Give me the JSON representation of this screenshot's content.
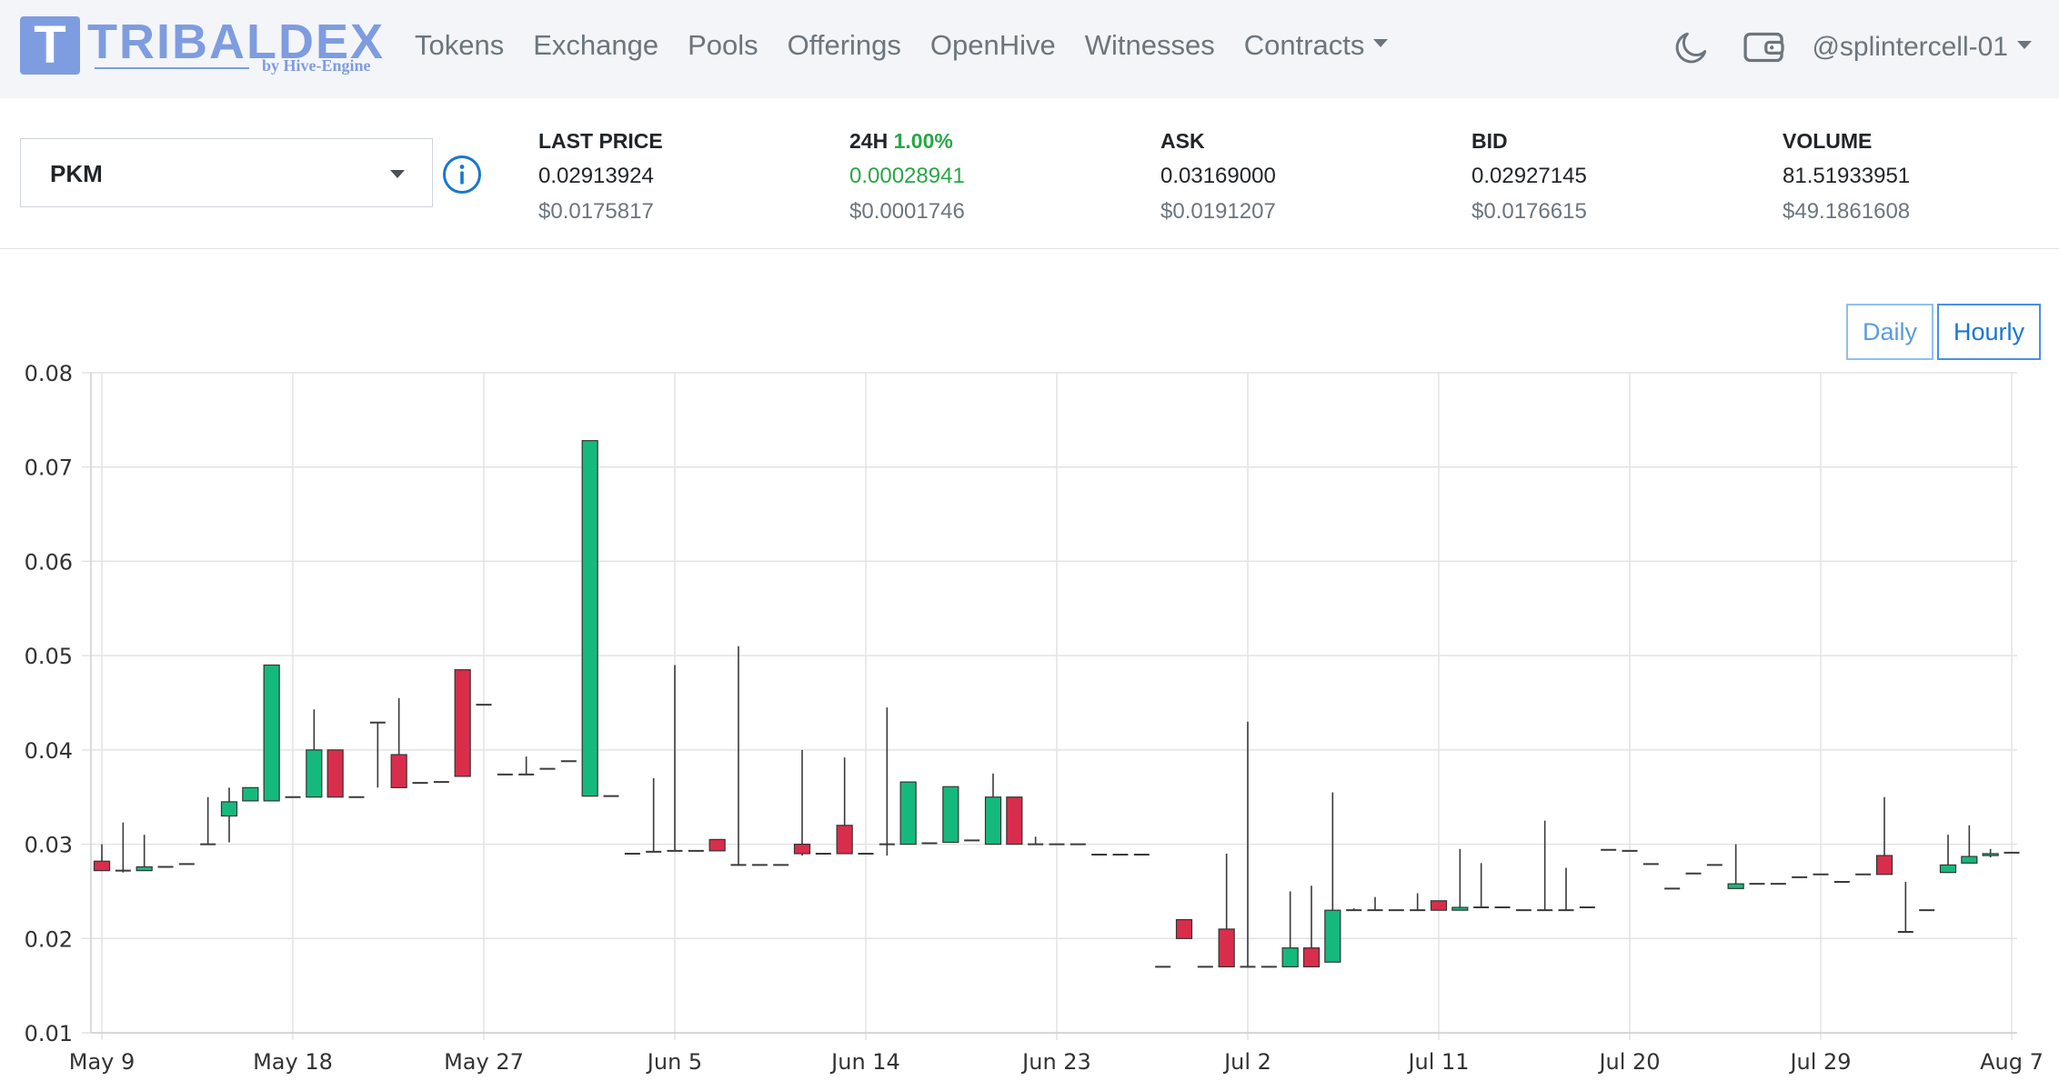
{
  "navbar": {
    "logo_letter": "T",
    "brand_name": "TRIBALDEX",
    "brand_sub": "by Hive-Engine",
    "links": [
      "Tokens",
      "Exchange",
      "Pools",
      "Offerings",
      "OpenHive",
      "Witnesses"
    ],
    "contracts_label": "Contracts",
    "account": "@splintercell-01"
  },
  "ticker": {
    "token": "PKM",
    "last_price": {
      "label": "LAST PRICE",
      "value": "0.02913924",
      "usd": "$0.0175817"
    },
    "change": {
      "label": "24H",
      "pct": "1.00%",
      "value": "0.00028941",
      "usd": "$0.0001746"
    },
    "ask": {
      "label": "ASK",
      "value": "0.03169000",
      "usd": "$0.0191207"
    },
    "bid": {
      "label": "BID",
      "value": "0.02927145",
      "usd": "$0.0176615"
    },
    "volume": {
      "label": "VOLUME",
      "value": "81.51933951",
      "usd": "$49.1861608"
    }
  },
  "chart_controls": {
    "daily": "Daily",
    "hourly": "Hourly"
  },
  "colors": {
    "up": "#16b97d",
    "down": "#d82e4c",
    "accent": "#1976d2",
    "brand": "#7e9ce0"
  },
  "chart_data": {
    "type": "candlestick",
    "ylim": [
      0.01,
      0.08
    ],
    "y_ticks": [
      "0.08",
      "0.07",
      "0.06",
      "0.05",
      "0.04",
      "0.03",
      "0.02",
      "0.01"
    ],
    "x_ticks": [
      "May 9",
      "May 18",
      "May 27",
      "Jun 5",
      "Jun 14",
      "Jun 23",
      "Jul 2",
      "Jul 11",
      "Jul 20",
      "Jul 29",
      "Aug 7"
    ],
    "x_start": "2021-05-09",
    "x_end": "2021-08-07",
    "grid": true,
    "candles": [
      {
        "d": "2021-05-09",
        "o": 0.0282,
        "h": 0.03,
        "l": 0.0272,
        "c": 0.0272
      },
      {
        "d": "2021-05-10",
        "o": 0.0272,
        "h": 0.0323,
        "l": 0.027,
        "c": 0.0272
      },
      {
        "d": "2021-05-11",
        "o": 0.0272,
        "h": 0.031,
        "l": 0.0272,
        "c": 0.0276
      },
      {
        "d": "2021-05-12",
        "o": 0.0276,
        "h": 0.0276,
        "l": 0.0276,
        "c": 0.0276
      },
      {
        "d": "2021-05-13",
        "o": 0.0279,
        "h": 0.0279,
        "l": 0.0279,
        "c": 0.0279
      },
      {
        "d": "2021-05-14",
        "o": 0.03,
        "h": 0.035,
        "l": 0.03,
        "c": 0.03
      },
      {
        "d": "2021-05-15",
        "o": 0.033,
        "h": 0.036,
        "l": 0.0302,
        "c": 0.0345
      },
      {
        "d": "2021-05-16",
        "o": 0.0346,
        "h": 0.036,
        "l": 0.0346,
        "c": 0.036
      },
      {
        "d": "2021-05-17",
        "o": 0.0346,
        "h": 0.049,
        "l": 0.0346,
        "c": 0.049
      },
      {
        "d": "2021-05-18",
        "o": 0.035,
        "h": 0.035,
        "l": 0.035,
        "c": 0.035
      },
      {
        "d": "2021-05-19",
        "o": 0.035,
        "h": 0.0443,
        "l": 0.035,
        "c": 0.04
      },
      {
        "d": "2021-05-20",
        "o": 0.04,
        "h": 0.04,
        "l": 0.035,
        "c": 0.035
      },
      {
        "d": "2021-05-21",
        "o": 0.035,
        "h": 0.035,
        "l": 0.035,
        "c": 0.035
      },
      {
        "d": "2021-05-22",
        "o": 0.0429,
        "h": 0.0429,
        "l": 0.036,
        "c": 0.0429
      },
      {
        "d": "2021-05-23",
        "o": 0.0395,
        "h": 0.0455,
        "l": 0.036,
        "c": 0.036
      },
      {
        "d": "2021-05-24",
        "o": 0.0365,
        "h": 0.0365,
        "l": 0.0365,
        "c": 0.0365
      },
      {
        "d": "2021-05-25",
        "o": 0.0366,
        "h": 0.0366,
        "l": 0.0366,
        "c": 0.0366
      },
      {
        "d": "2021-05-26",
        "o": 0.0485,
        "h": 0.0485,
        "l": 0.0372,
        "c": 0.0372
      },
      {
        "d": "2021-05-27",
        "o": 0.0448,
        "h": 0.0448,
        "l": 0.0448,
        "c": 0.0448
      },
      {
        "d": "2021-05-28",
        "o": 0.0374,
        "h": 0.0374,
        "l": 0.0374,
        "c": 0.0374
      },
      {
        "d": "2021-05-29",
        "o": 0.0374,
        "h": 0.0393,
        "l": 0.0374,
        "c": 0.0374
      },
      {
        "d": "2021-05-30",
        "o": 0.038,
        "h": 0.038,
        "l": 0.038,
        "c": 0.038
      },
      {
        "d": "2021-05-31",
        "o": 0.0388,
        "h": 0.0388,
        "l": 0.0388,
        "c": 0.0388
      },
      {
        "d": "2021-06-01",
        "o": 0.0351,
        "h": 0.0728,
        "l": 0.0351,
        "c": 0.0728
      },
      {
        "d": "2021-06-02",
        "o": 0.0351,
        "h": 0.0351,
        "l": 0.0351,
        "c": 0.0351
      },
      {
        "d": "2021-06-03",
        "o": 0.029,
        "h": 0.029,
        "l": 0.029,
        "c": 0.029
      },
      {
        "d": "2021-06-04",
        "o": 0.0292,
        "h": 0.037,
        "l": 0.0292,
        "c": 0.0292
      },
      {
        "d": "2021-06-05",
        "o": 0.0293,
        "h": 0.049,
        "l": 0.0293,
        "c": 0.0293
      },
      {
        "d": "2021-06-06",
        "o": 0.0293,
        "h": 0.0293,
        "l": 0.0293,
        "c": 0.0293
      },
      {
        "d": "2021-06-07",
        "o": 0.0305,
        "h": 0.0305,
        "l": 0.0293,
        "c": 0.0293
      },
      {
        "d": "2021-06-08",
        "o": 0.0278,
        "h": 0.051,
        "l": 0.0278,
        "c": 0.0278
      },
      {
        "d": "2021-06-09",
        "o": 0.0278,
        "h": 0.0278,
        "l": 0.0278,
        "c": 0.0278
      },
      {
        "d": "2021-06-10",
        "o": 0.0278,
        "h": 0.0278,
        "l": 0.0278,
        "c": 0.0278
      },
      {
        "d": "2021-06-11",
        "o": 0.03,
        "h": 0.04,
        "l": 0.0288,
        "c": 0.029
      },
      {
        "d": "2021-06-12",
        "o": 0.029,
        "h": 0.029,
        "l": 0.029,
        "c": 0.029
      },
      {
        "d": "2021-06-13",
        "o": 0.032,
        "h": 0.0392,
        "l": 0.029,
        "c": 0.029
      },
      {
        "d": "2021-06-14",
        "o": 0.029,
        "h": 0.029,
        "l": 0.029,
        "c": 0.029
      },
      {
        "d": "2021-06-15",
        "o": 0.03,
        "h": 0.0445,
        "l": 0.0288,
        "c": 0.03
      },
      {
        "d": "2021-06-16",
        "o": 0.03,
        "h": 0.0366,
        "l": 0.03,
        "c": 0.0366
      },
      {
        "d": "2021-06-17",
        "o": 0.0301,
        "h": 0.0301,
        "l": 0.0301,
        "c": 0.0301
      },
      {
        "d": "2021-06-18",
        "o": 0.0302,
        "h": 0.0361,
        "l": 0.0302,
        "c": 0.0361
      },
      {
        "d": "2021-06-19",
        "o": 0.0304,
        "h": 0.0304,
        "l": 0.0304,
        "c": 0.0304
      },
      {
        "d": "2021-06-20",
        "o": 0.03,
        "h": 0.0375,
        "l": 0.03,
        "c": 0.035
      },
      {
        "d": "2021-06-21",
        "o": 0.035,
        "h": 0.035,
        "l": 0.03,
        "c": 0.03
      },
      {
        "d": "2021-06-22",
        "o": 0.03,
        "h": 0.0308,
        "l": 0.03,
        "c": 0.03
      },
      {
        "d": "2021-06-23",
        "o": 0.03,
        "h": 0.03,
        "l": 0.03,
        "c": 0.03
      },
      {
        "d": "2021-06-24",
        "o": 0.03,
        "h": 0.03,
        "l": 0.03,
        "c": 0.03
      },
      {
        "d": "2021-06-25",
        "o": 0.0289,
        "h": 0.0289,
        "l": 0.0289,
        "c": 0.0289
      },
      {
        "d": "2021-06-26",
        "o": 0.0289,
        "h": 0.0289,
        "l": 0.0289,
        "c": 0.0289
      },
      {
        "d": "2021-06-27",
        "o": 0.0289,
        "h": 0.0289,
        "l": 0.0289,
        "c": 0.0289
      },
      {
        "d": "2021-06-28",
        "o": 0.017,
        "h": 0.017,
        "l": 0.017,
        "c": 0.017
      },
      {
        "d": "2021-06-29",
        "o": 0.022,
        "h": 0.022,
        "l": 0.02,
        "c": 0.02
      },
      {
        "d": "2021-06-30",
        "o": 0.017,
        "h": 0.017,
        "l": 0.017,
        "c": 0.017
      },
      {
        "d": "2021-07-01",
        "o": 0.021,
        "h": 0.029,
        "l": 0.017,
        "c": 0.017
      },
      {
        "d": "2021-07-02",
        "o": 0.017,
        "h": 0.043,
        "l": 0.017,
        "c": 0.017
      },
      {
        "d": "2021-07-03",
        "o": 0.017,
        "h": 0.017,
        "l": 0.017,
        "c": 0.017
      },
      {
        "d": "2021-07-04",
        "o": 0.017,
        "h": 0.025,
        "l": 0.017,
        "c": 0.019
      },
      {
        "d": "2021-07-05",
        "o": 0.019,
        "h": 0.0256,
        "l": 0.017,
        "c": 0.017
      },
      {
        "d": "2021-07-06",
        "o": 0.0175,
        "h": 0.0355,
        "l": 0.0175,
        "c": 0.023
      },
      {
        "d": "2021-07-07",
        "o": 0.023,
        "h": 0.0232,
        "l": 0.023,
        "c": 0.023
      },
      {
        "d": "2021-07-08",
        "o": 0.023,
        "h": 0.0244,
        "l": 0.023,
        "c": 0.023
      },
      {
        "d": "2021-07-09",
        "o": 0.023,
        "h": 0.023,
        "l": 0.023,
        "c": 0.023
      },
      {
        "d": "2021-07-10",
        "o": 0.023,
        "h": 0.0248,
        "l": 0.023,
        "c": 0.023
      },
      {
        "d": "2021-07-11",
        "o": 0.024,
        "h": 0.024,
        "l": 0.023,
        "c": 0.023
      },
      {
        "d": "2021-07-12",
        "o": 0.023,
        "h": 0.0295,
        "l": 0.023,
        "c": 0.0233
      },
      {
        "d": "2021-07-13",
        "o": 0.0233,
        "h": 0.028,
        "l": 0.0233,
        "c": 0.0233
      },
      {
        "d": "2021-07-14",
        "o": 0.0233,
        "h": 0.0233,
        "l": 0.0233,
        "c": 0.0233
      },
      {
        "d": "2021-07-15",
        "o": 0.023,
        "h": 0.023,
        "l": 0.023,
        "c": 0.023
      },
      {
        "d": "2021-07-16",
        "o": 0.023,
        "h": 0.0325,
        "l": 0.023,
        "c": 0.023
      },
      {
        "d": "2021-07-17",
        "o": 0.023,
        "h": 0.0275,
        "l": 0.023,
        "c": 0.023
      },
      {
        "d": "2021-07-18",
        "o": 0.0233,
        "h": 0.0233,
        "l": 0.0233,
        "c": 0.0233
      },
      {
        "d": "2021-07-19",
        "o": 0.0294,
        "h": 0.0294,
        "l": 0.0294,
        "c": 0.0294
      },
      {
        "d": "2021-07-20",
        "o": 0.0293,
        "h": 0.0293,
        "l": 0.0293,
        "c": 0.0293
      },
      {
        "d": "2021-07-21",
        "o": 0.0279,
        "h": 0.0279,
        "l": 0.0279,
        "c": 0.0279
      },
      {
        "d": "2021-07-22",
        "o": 0.0253,
        "h": 0.0253,
        "l": 0.0253,
        "c": 0.0253
      },
      {
        "d": "2021-07-23",
        "o": 0.0269,
        "h": 0.0269,
        "l": 0.0269,
        "c": 0.0269
      },
      {
        "d": "2021-07-24",
        "o": 0.0278,
        "h": 0.0278,
        "l": 0.0278,
        "c": 0.0278
      },
      {
        "d": "2021-07-25",
        "o": 0.0253,
        "h": 0.03,
        "l": 0.0253,
        "c": 0.0258
      },
      {
        "d": "2021-07-26",
        "o": 0.0258,
        "h": 0.0258,
        "l": 0.0258,
        "c": 0.0258
      },
      {
        "d": "2021-07-27",
        "o": 0.0258,
        "h": 0.0258,
        "l": 0.0258,
        "c": 0.0258
      },
      {
        "d": "2021-07-28",
        "o": 0.0265,
        "h": 0.0265,
        "l": 0.0265,
        "c": 0.0265
      },
      {
        "d": "2021-07-29",
        "o": 0.0268,
        "h": 0.0268,
        "l": 0.0268,
        "c": 0.0268
      },
      {
        "d": "2021-07-30",
        "o": 0.026,
        "h": 0.026,
        "l": 0.026,
        "c": 0.026
      },
      {
        "d": "2021-07-31",
        "o": 0.0268,
        "h": 0.0268,
        "l": 0.0268,
        "c": 0.0268
      },
      {
        "d": "2021-08-01",
        "o": 0.0288,
        "h": 0.035,
        "l": 0.0268,
        "c": 0.0268
      },
      {
        "d": "2021-08-02",
        "o": 0.0207,
        "h": 0.026,
        "l": 0.0207,
        "c": 0.0207
      },
      {
        "d": "2021-08-03",
        "o": 0.023,
        "h": 0.023,
        "l": 0.023,
        "c": 0.023
      },
      {
        "d": "2021-08-04",
        "o": 0.027,
        "h": 0.031,
        "l": 0.027,
        "c": 0.0278
      },
      {
        "d": "2021-08-05",
        "o": 0.028,
        "h": 0.032,
        "l": 0.028,
        "c": 0.0287
      },
      {
        "d": "2021-08-06",
        "o": 0.0288,
        "h": 0.0295,
        "l": 0.0286,
        "c": 0.029
      },
      {
        "d": "2021-08-07",
        "o": 0.0291,
        "h": 0.0291,
        "l": 0.0291,
        "c": 0.0291
      }
    ]
  }
}
